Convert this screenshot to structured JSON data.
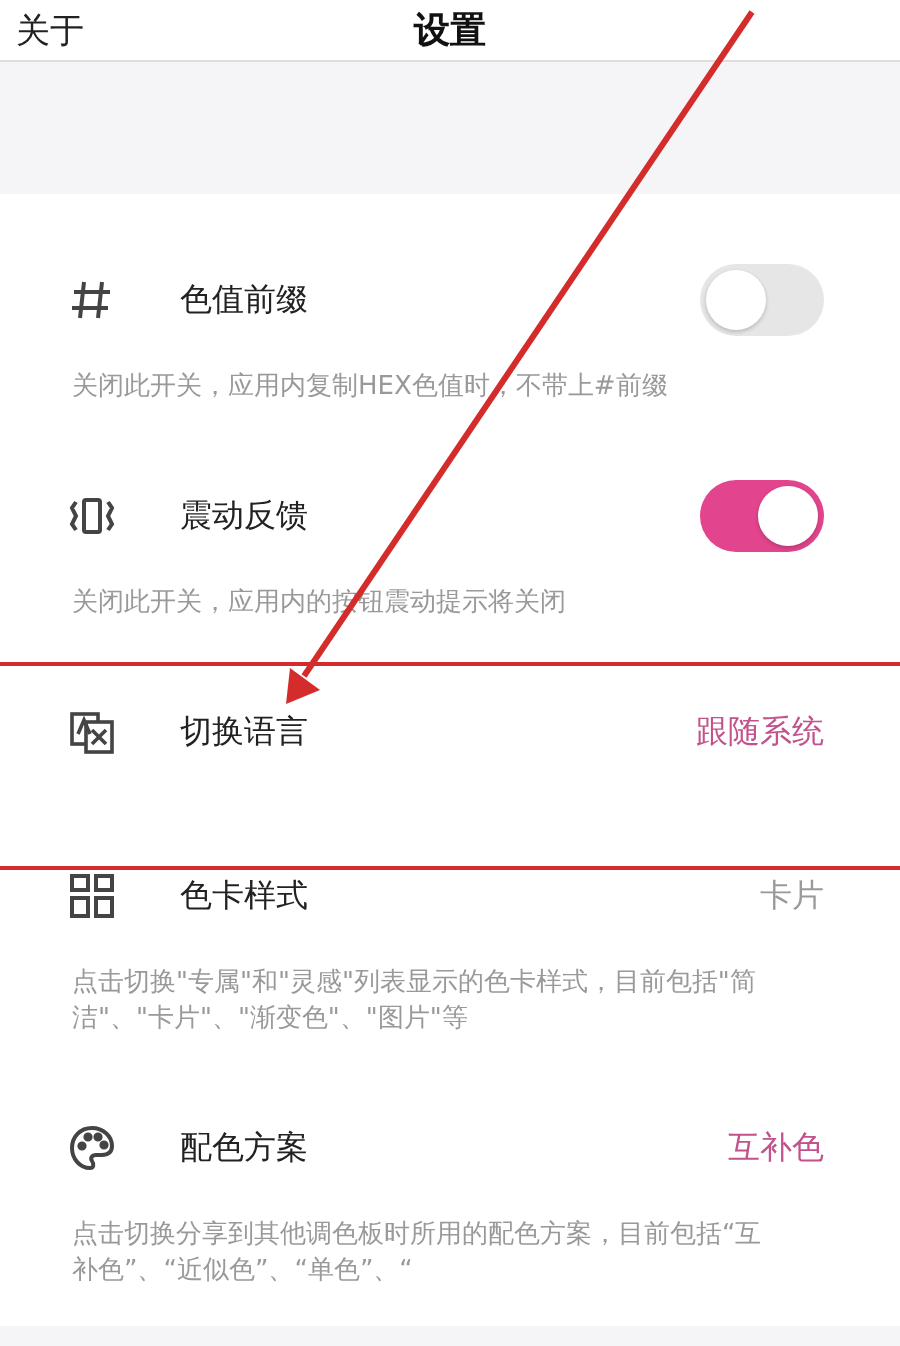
{
  "header": {
    "back": "关于",
    "title": "设置"
  },
  "settings": [
    {
      "kind": "toggle",
      "title": "色值前缀",
      "on": false,
      "description": "关闭此开关，应用内复制HEX色值时，不带上#前缀"
    },
    {
      "kind": "toggle",
      "title": "震动反馈",
      "on": true,
      "description": "关闭此开关，应用内的按钮震动提示将关闭"
    },
    {
      "kind": "value",
      "title": "切换语言",
      "value": "跟随系统",
      "color": "#c2528c"
    },
    {
      "kind": "value",
      "title": "色卡样式",
      "value": "卡片",
      "color": "#9a9a9a",
      "description": "点击切换\"专属\"和\"灵感\"列表显示的色卡样式，目前包括\"简洁\"、\"卡片\"、\"渐变色\"、\"图片\"等"
    },
    {
      "kind": "value",
      "title": "配色方案",
      "value": "互补色",
      "color": "#c2528c",
      "description": "点击切换分享到其他调色板时所用的配色方案，目前包括“互补色”、“近似色”、“单色”、“"
    }
  ]
}
